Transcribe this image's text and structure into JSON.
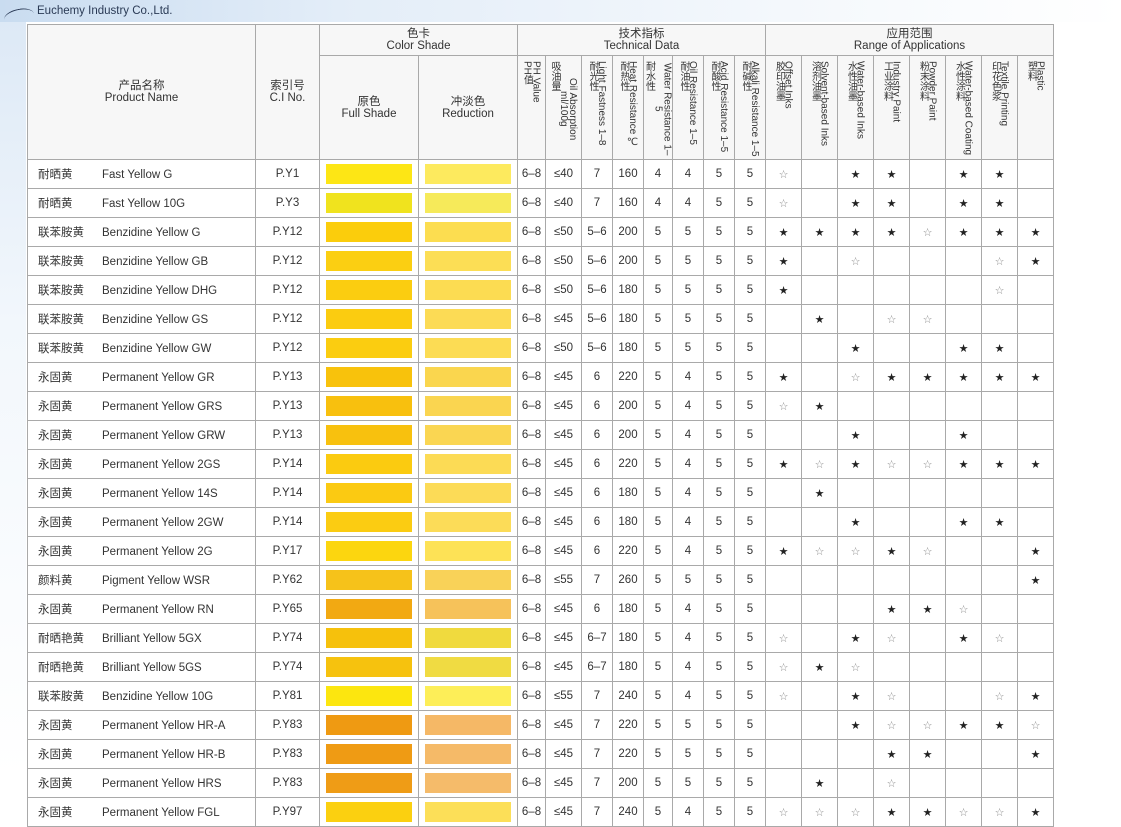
{
  "company": "Euchemy Industry Co.,Ltd.",
  "headers": {
    "product_name": {
      "cn": "产品名称",
      "en": "Product Name"
    },
    "ci_no": {
      "cn": "索引号",
      "en": "C.I No."
    },
    "color_shade": {
      "cn": "色卡",
      "en": "Color Shade"
    },
    "full_shade": {
      "cn": "原色",
      "en": "Full Shade"
    },
    "reduction": {
      "cn": "冲淡色",
      "en": "Reduction"
    },
    "technical": {
      "cn": "技术指标",
      "en": "Technical Data"
    },
    "applications": {
      "cn": "应用范围",
      "en": "Range of Applications"
    },
    "tech_columns": [
      {
        "cn": "PH值",
        "en": "PH Value"
      },
      {
        "cn": "吸油量",
        "en": "Oil Absorption ml/100g"
      },
      {
        "cn": "耐光性",
        "en": "Light Fastness 1–8"
      },
      {
        "cn": "耐热性",
        "en": "Heat Resistance ℃"
      },
      {
        "cn": "耐水性",
        "en": "Water Resistance 1–5"
      },
      {
        "cn": "耐油性",
        "en": "Oil Resistance 1–5"
      },
      {
        "cn": "耐酸性",
        "en": "Acid Resistance 1–5"
      },
      {
        "cn": "耐碱性",
        "en": "Alkali Resistance 1–5"
      }
    ],
    "app_columns": [
      {
        "cn": "胶印油墨",
        "en": "Offset Inks"
      },
      {
        "cn": "溶剂油墨",
        "en": "Solvent-based Inks"
      },
      {
        "cn": "水性油墨",
        "en": "Water-based Inks"
      },
      {
        "cn": "工业涂料",
        "en": "Industry Paint"
      },
      {
        "cn": "粉末涂料",
        "en": "Powder Paint"
      },
      {
        "cn": "水性涂料",
        "en": "Water-based Coating"
      },
      {
        "cn": "印花色浆",
        "en": "Textile Printing"
      },
      {
        "cn": "塑料",
        "en": "Plastic"
      }
    ]
  },
  "rows": [
    {
      "cn": "耐晒黄",
      "en": "Fast Yellow G",
      "ci": "P.Y1",
      "full": "#fde615",
      "red": "#fdea5e",
      "tech": [
        "6–8",
        "≤40",
        "7",
        "160",
        "4",
        "4",
        "5",
        "5"
      ],
      "apps": [
        "☆",
        "",
        "★",
        "★",
        "",
        "★",
        "★",
        ""
      ]
    },
    {
      "cn": "耐晒黄",
      "en": "Fast Yellow 10G",
      "ci": "P.Y3",
      "full": "#f0e31e",
      "red": "#f6ea5a",
      "tech": [
        "6–8",
        "≤40",
        "7",
        "160",
        "4",
        "4",
        "5",
        "5"
      ],
      "apps": [
        "☆",
        "",
        "★",
        "★",
        "",
        "★",
        "★",
        ""
      ]
    },
    {
      "cn": "联苯胺黄",
      "en": "Benzidine Yellow G",
      "ci": "P.Y12",
      "full": "#fbcd0c",
      "red": "#fcdd50",
      "tech": [
        "6–8",
        "≤50",
        "5–6",
        "200",
        "5",
        "5",
        "5",
        "5"
      ],
      "apps": [
        "★",
        "★",
        "★",
        "★",
        "☆",
        "★",
        "★",
        "★"
      ]
    },
    {
      "cn": "联苯胺黄",
      "en": "Benzidine Yellow GB",
      "ci": "P.Y12",
      "full": "#fbcf12",
      "red": "#fcde55",
      "tech": [
        "6–8",
        "≤50",
        "5–6",
        "200",
        "5",
        "5",
        "5",
        "5"
      ],
      "apps": [
        "★",
        "",
        "☆",
        "",
        "",
        "",
        "☆",
        "★"
      ]
    },
    {
      "cn": "联苯胺黄",
      "en": "Benzidine Yellow DHG",
      "ci": "P.Y12",
      "full": "#fbcd10",
      "red": "#fcdc52",
      "tech": [
        "6–8",
        "≤50",
        "5–6",
        "180",
        "5",
        "5",
        "5",
        "5"
      ],
      "apps": [
        "★",
        "",
        "",
        "",
        "",
        "",
        "☆",
        ""
      ]
    },
    {
      "cn": "联苯胺黄",
      "en": "Benzidine Yellow GS",
      "ci": "P.Y12",
      "full": "#fbcc10",
      "red": "#fcdb55",
      "tech": [
        "6–8",
        "≤45",
        "5–6",
        "180",
        "5",
        "5",
        "5",
        "5"
      ],
      "apps": [
        "",
        "★",
        "",
        "☆",
        "☆",
        "",
        "",
        ""
      ]
    },
    {
      "cn": "联苯胺黄",
      "en": "Benzidine Yellow GW",
      "ci": "P.Y12",
      "full": "#fbcd10",
      "red": "#fcdc54",
      "tech": [
        "6–8",
        "≤50",
        "5–6",
        "180",
        "5",
        "5",
        "5",
        "5"
      ],
      "apps": [
        "",
        "",
        "★",
        "",
        "",
        "★",
        "★",
        ""
      ]
    },
    {
      "cn": "永固黄",
      "en": "Permanent Yellow GR",
      "ci": "P.Y13",
      "full": "#f8c20c",
      "red": "#fad64e",
      "tech": [
        "6–8",
        "≤45",
        "6",
        "220",
        "5",
        "4",
        "5",
        "5"
      ],
      "apps": [
        "★",
        "",
        "☆",
        "★",
        "★",
        "★",
        "★",
        "★"
      ]
    },
    {
      "cn": "永固黄",
      "en": "Permanent Yellow GRS",
      "ci": "P.Y13",
      "full": "#f8c00e",
      "red": "#fad550",
      "tech": [
        "6–8",
        "≤45",
        "6",
        "200",
        "5",
        "4",
        "5",
        "5"
      ],
      "apps": [
        "☆",
        "★",
        "",
        "",
        "",
        "",
        "",
        ""
      ]
    },
    {
      "cn": "永固黄",
      "en": "Permanent Yellow GRW",
      "ci": "P.Y13",
      "full": "#f8c10e",
      "red": "#fad652",
      "tech": [
        "6–8",
        "≤45",
        "6",
        "200",
        "5",
        "4",
        "5",
        "5"
      ],
      "apps": [
        "",
        "",
        "★",
        "",
        "",
        "★",
        "",
        ""
      ]
    },
    {
      "cn": "永固黄",
      "en": "Permanent Yellow 2GS",
      "ci": "P.Y14",
      "full": "#fbcb10",
      "red": "#fcdb55",
      "tech": [
        "6–8",
        "≤45",
        "6",
        "220",
        "5",
        "4",
        "5",
        "5"
      ],
      "apps": [
        "★",
        "☆",
        "★",
        "☆",
        "☆",
        "★",
        "★",
        "★"
      ]
    },
    {
      "cn": "永固黄",
      "en": "Permanent Yellow 14S",
      "ci": "P.Y14",
      "full": "#fbca12",
      "red": "#fcdb57",
      "tech": [
        "6–8",
        "≤45",
        "6",
        "180",
        "5",
        "4",
        "5",
        "5"
      ],
      "apps": [
        "",
        "★",
        "",
        "",
        "",
        "",
        "",
        ""
      ]
    },
    {
      "cn": "永固黄",
      "en": "Permanent Yellow 2GW",
      "ci": "P.Y14",
      "full": "#fbcc12",
      "red": "#fcdc58",
      "tech": [
        "6–8",
        "≤45",
        "6",
        "180",
        "5",
        "4",
        "5",
        "5"
      ],
      "apps": [
        "",
        "",
        "★",
        "",
        "",
        "★",
        "★",
        ""
      ]
    },
    {
      "cn": "永固黄",
      "en": "Permanent Yellow 2G",
      "ci": "P.Y17",
      "full": "#fcd60f",
      "red": "#fde256",
      "tech": [
        "6–8",
        "≤45",
        "6",
        "220",
        "5",
        "4",
        "5",
        "5"
      ],
      "apps": [
        "★",
        "☆",
        "☆",
        "★",
        "☆",
        "",
        "",
        "★"
      ]
    },
    {
      "cn": "颜料黄",
      "en": "Pigment Yellow WSR",
      "ci": "P.Y62",
      "full": "#f6c21a",
      "red": "#f9d258",
      "tech": [
        "6–8",
        "≤55",
        "7",
        "260",
        "5",
        "5",
        "5",
        "5"
      ],
      "apps": [
        "",
        "",
        "",
        "",
        "",
        "",
        "",
        "★"
      ]
    },
    {
      "cn": "永固黄",
      "en": "Permanent Yellow RN",
      "ci": "P.Y65",
      "full": "#f2a912",
      "red": "#f6c25a",
      "tech": [
        "6–8",
        "≤45",
        "6",
        "180",
        "5",
        "4",
        "5",
        "5"
      ],
      "apps": [
        "",
        "",
        "",
        "★",
        "★",
        "☆",
        "",
        ""
      ]
    },
    {
      "cn": "耐晒艳黄",
      "en": "Brilliant Yellow 5GX",
      "ci": "P.Y74",
      "full": "#f6c10c",
      "red": "#f0da3e",
      "tech": [
        "6–8",
        "≤45",
        "6–7",
        "180",
        "5",
        "4",
        "5",
        "5"
      ],
      "apps": [
        "☆",
        "",
        "★",
        "☆",
        "",
        "★",
        "☆",
        ""
      ]
    },
    {
      "cn": "耐晒艳黄",
      "en": "Brilliant Yellow 5GS",
      "ci": "P.Y74",
      "full": "#f6c20e",
      "red": "#f0db42",
      "tech": [
        "6–8",
        "≤45",
        "6–7",
        "180",
        "5",
        "4",
        "5",
        "5"
      ],
      "apps": [
        "☆",
        "★",
        "☆",
        "",
        "",
        "",
        "",
        ""
      ]
    },
    {
      "cn": "联苯胺黄",
      "en": "Benzidine Yellow 10G",
      "ci": "P.Y81",
      "full": "#fce60f",
      "red": "#fdee58",
      "tech": [
        "6–8",
        "≤55",
        "7",
        "240",
        "5",
        "4",
        "5",
        "5"
      ],
      "apps": [
        "☆",
        "",
        "★",
        "☆",
        "",
        "",
        "☆",
        "★"
      ]
    },
    {
      "cn": "永固黄",
      "en": "Permanent Yellow HR-A",
      "ci": "P.Y83",
      "full": "#ef9a12",
      "red": "#f5b866",
      "tech": [
        "6–8",
        "≤45",
        "7",
        "220",
        "5",
        "5",
        "5",
        "5"
      ],
      "apps": [
        "",
        "",
        "★",
        "☆",
        "☆",
        "★",
        "★",
        "☆"
      ]
    },
    {
      "cn": "永固黄",
      "en": "Permanent Yellow HR-B",
      "ci": "P.Y83",
      "full": "#ef9b14",
      "red": "#f5ba68",
      "tech": [
        "6–8",
        "≤45",
        "7",
        "220",
        "5",
        "5",
        "5",
        "5"
      ],
      "apps": [
        "",
        "",
        "",
        "★",
        "★",
        "",
        "",
        "★"
      ]
    },
    {
      "cn": "永固黄",
      "en": "Permanent Yellow HRS",
      "ci": "P.Y83",
      "full": "#ef9c16",
      "red": "#f5bb6a",
      "tech": [
        "6–8",
        "≤45",
        "7",
        "200",
        "5",
        "5",
        "5",
        "5"
      ],
      "apps": [
        "",
        "★",
        "",
        "☆",
        "",
        "",
        "",
        ""
      ]
    },
    {
      "cn": "永固黄",
      "en": "Permanent Yellow FGL",
      "ci": "P.Y97",
      "full": "#fbd010",
      "red": "#fcdf58",
      "tech": [
        "6–8",
        "≤45",
        "7",
        "240",
        "5",
        "4",
        "5",
        "5"
      ],
      "apps": [
        "☆",
        "☆",
        "☆",
        "★",
        "★",
        "☆",
        "☆",
        "★"
      ]
    }
  ]
}
